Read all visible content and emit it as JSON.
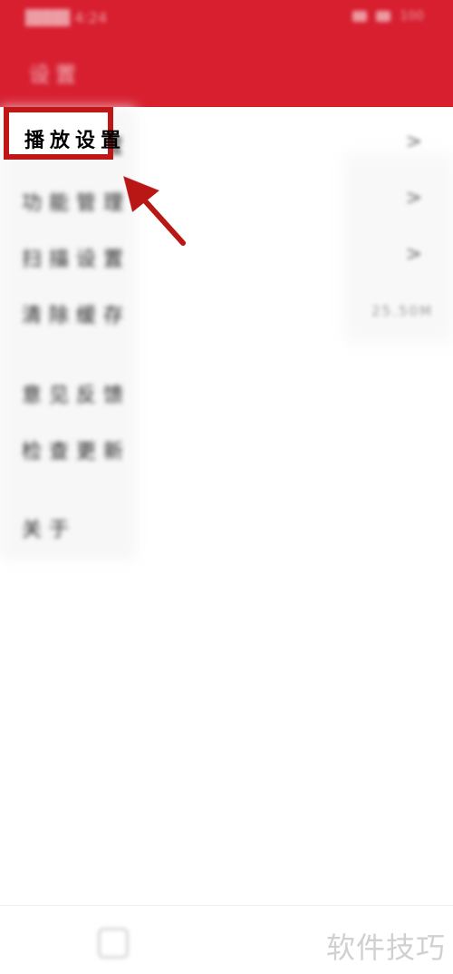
{
  "status_bar": {
    "left_text": "████ 4:24",
    "right_text": "100"
  },
  "header": {
    "title": "设置"
  },
  "settings": {
    "items": [
      {
        "label": "播放设置",
        "right": ">"
      },
      {
        "label": "功能管理",
        "right": ">"
      },
      {
        "label": "扫描设置",
        "right": ">"
      },
      {
        "label": "清除缓存",
        "right": "25.50M"
      },
      {
        "label": "意见反馈",
        "right": ""
      },
      {
        "label": "检查更新",
        "right": ""
      },
      {
        "label": "关于",
        "right": ""
      }
    ]
  },
  "watermark": {
    "text": "软件技巧"
  },
  "colors": {
    "header": "#d71f30",
    "highlight": "#be1718"
  }
}
